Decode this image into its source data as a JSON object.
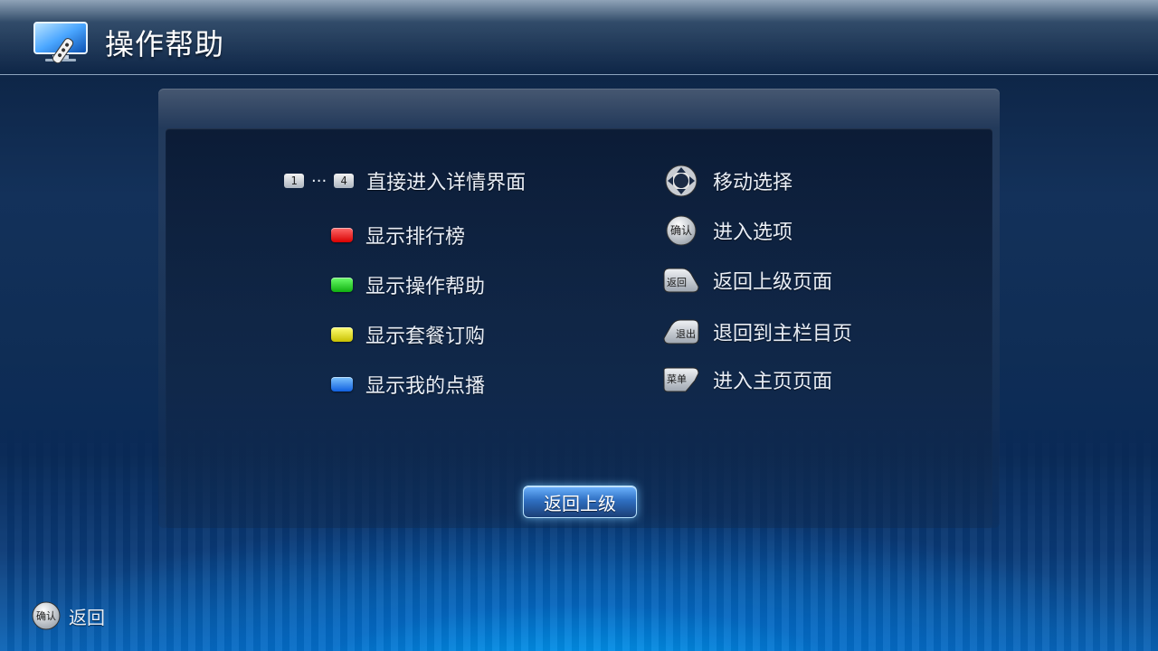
{
  "header": {
    "title": "操作帮助",
    "icon": "tv-remote-icon"
  },
  "left_keys": {
    "numbers": {
      "start": "1",
      "ellipsis": "···",
      "end": "4",
      "label": "直接进入详情界面"
    },
    "items": [
      {
        "key_color": "#e00000",
        "icon": "red-key-icon",
        "label": "显示排行榜"
      },
      {
        "key_color": "#12c012",
        "icon": "green-key-icon",
        "label": "显示操作帮助"
      },
      {
        "key_color": "#d8d000",
        "icon": "yellow-key-icon",
        "label": "显示套餐订购"
      },
      {
        "key_color": "#1a73e8",
        "icon": "blue-key-icon",
        "label": "显示我的点播"
      }
    ]
  },
  "right_keys": [
    {
      "icon": "dpad-icon",
      "key_text": "",
      "label": "移动选择"
    },
    {
      "icon": "ok-key-icon",
      "key_text": "确认",
      "label": "进入选项"
    },
    {
      "icon": "return-key-icon",
      "key_text": "返回",
      "label": "返回上级页面"
    },
    {
      "icon": "exit-key-icon",
      "key_text": "退出",
      "label": "退回到主栏目页"
    },
    {
      "icon": "menu-key-icon",
      "key_text": "菜单",
      "label": "进入主页页面"
    }
  ],
  "actions": {
    "back_label": "返回上级"
  },
  "footer": {
    "key_text": "确认",
    "label": "返回"
  }
}
